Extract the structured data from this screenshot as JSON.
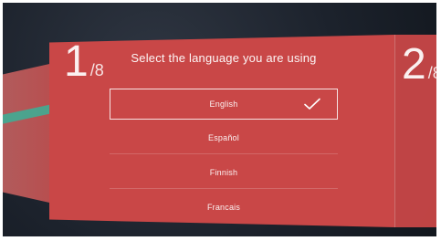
{
  "header": {
    "title": "Select the language you are using"
  },
  "progress": {
    "current": {
      "numerator": "1",
      "denominator": "/8"
    },
    "next": {
      "numerator": "2",
      "denominator": "/8"
    }
  },
  "languages": {
    "items": [
      {
        "label": "English",
        "selected": true
      },
      {
        "label": "Español",
        "selected": false
      },
      {
        "label": "Finnish",
        "selected": false
      },
      {
        "label": "Francais",
        "selected": false
      }
    ]
  },
  "colors": {
    "panel_red": "#c94747",
    "check_white": "#ffffff"
  },
  "icons": {
    "selected_check": "check-icon"
  }
}
